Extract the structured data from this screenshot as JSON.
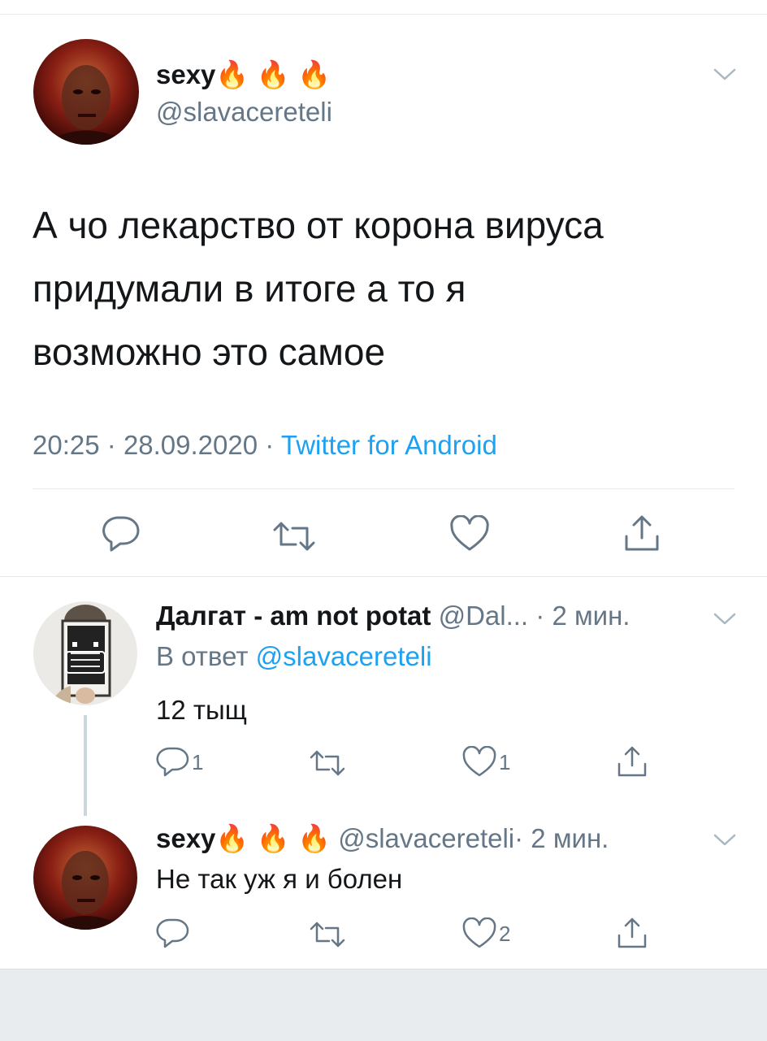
{
  "main_tweet": {
    "display_name": "sexy",
    "emoji": [
      "🔥",
      "🔥",
      "🔥"
    ],
    "handle": "@slavacereteli",
    "text_lines": [
      "А чо лекарство от корона вируса",
      "придумали в итоге а то я",
      "возможно это самое"
    ],
    "time": "20:25",
    "date": "28.09.2020",
    "separator": "·",
    "source": "Twitter for Android"
  },
  "reply_1": {
    "display_name": "Далгат - am not potat",
    "handle": "@Dal...",
    "time_ago": "· 2 мин.",
    "reply_to_prefix": "В ответ",
    "reply_to_handle": "@slavacereteli",
    "text": "12 тыщ",
    "reply_count": "1",
    "like_count": "1"
  },
  "reply_2": {
    "display_name": "sexy",
    "emoji": [
      "🔥",
      "🔥",
      "🔥"
    ],
    "handle": "@slavacereteli",
    "time_ago": "· 2 мин.",
    "text": "Не так уж я и болен",
    "like_count": "2"
  },
  "colors": {
    "link": "#1da1f2",
    "secondary": "#657786",
    "divider": "#e6ecf0",
    "text": "#14171a"
  },
  "icons": [
    "reply-icon",
    "retweet-icon",
    "like-icon",
    "share-icon",
    "chevron-down-icon"
  ]
}
